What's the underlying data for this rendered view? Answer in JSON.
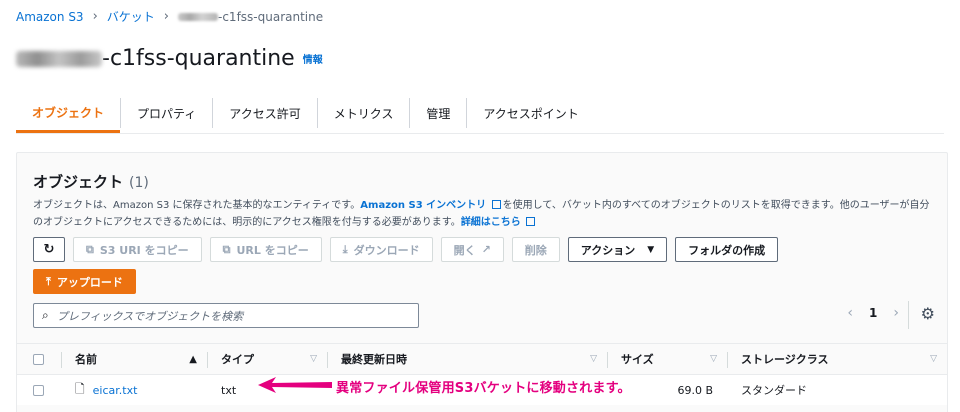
{
  "breadcrumb": {
    "root": "Amazon S3",
    "buckets": "バケット",
    "current_suffix": "-c1fss-quarantine"
  },
  "header": {
    "title_suffix": "-c1fss-quarantine",
    "info": "情報"
  },
  "tabs": [
    "オブジェクト",
    "プロパティ",
    "アクセス許可",
    "メトリクス",
    "管理",
    "アクセスポイント"
  ],
  "panel": {
    "title": "オブジェクト",
    "count": "(1)",
    "desc_1": "オブジェクトは、Amazon S3 に保存された基本的なエンティティです。",
    "desc_link_1": "Amazon S3 インベントリ",
    "desc_2": "を使用して、バケット内のすべてのオブジェクトのリストを取得できます。他のユーザーが自分のオブジェクトにアクセスできるためには、明示的にアクセス権限を付与する必要があります。",
    "desc_link_2": "詳細はこちら"
  },
  "toolbar": {
    "refresh_icon": "refresh-icon",
    "copy_s3_uri": "S3 URI をコピー",
    "copy_url": "URL をコピー",
    "download": "ダウンロード",
    "open": "開く",
    "delete": "削除",
    "actions": "アクション",
    "create_folder": "フォルダの作成",
    "upload": "アップロード"
  },
  "search": {
    "placeholder": "プレフィックスでオブジェクトを検索"
  },
  "pagination": {
    "page": "1"
  },
  "table": {
    "columns": [
      "名前",
      "タイプ",
      "最終更新日時",
      "サイズ",
      "ストレージクラス"
    ],
    "rows": [
      {
        "name": "eicar.txt",
        "type": "txt",
        "modified": "",
        "size": "69.0 B",
        "storage_class": "スタンダード"
      }
    ]
  },
  "annotation": {
    "text": "異常ファイル保管用S3バケットに移動されます。",
    "color": "#e4007f"
  },
  "colors": {
    "accent": "#ec7211",
    "link": "#0972d3"
  }
}
